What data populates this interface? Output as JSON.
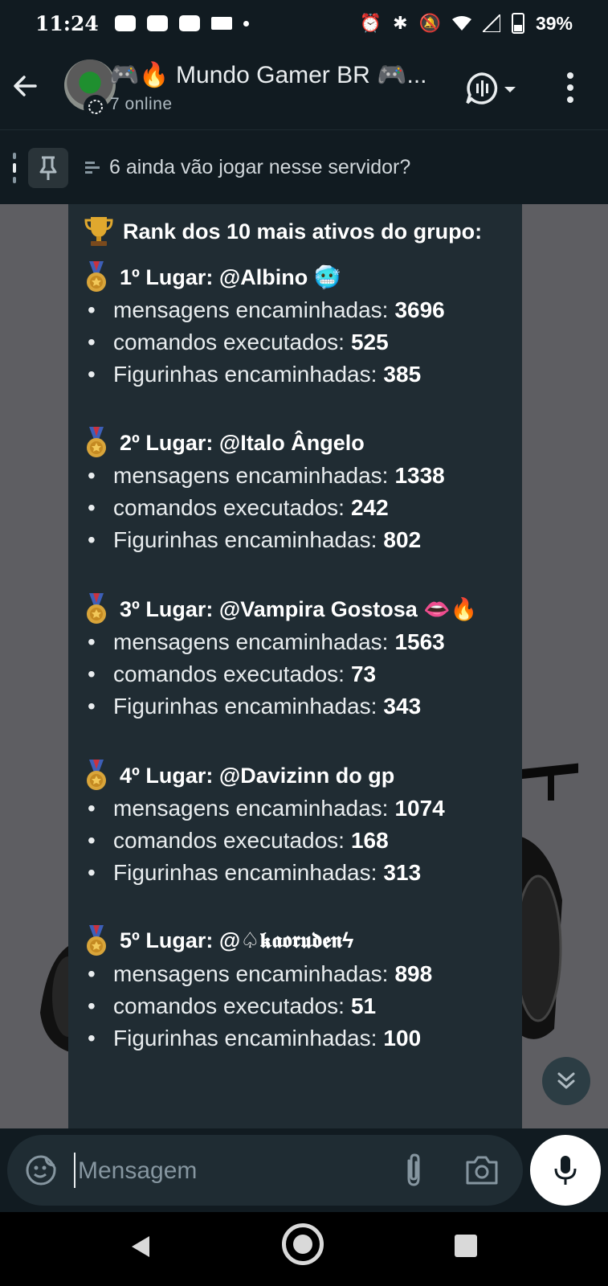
{
  "status_bar": {
    "time": "11:24",
    "battery": "39%"
  },
  "header": {
    "group_name": "🎮🔥 Mundo Gamer BR 🎮...",
    "online": "7 online"
  },
  "pinned": {
    "text": "6 ainda vão jogar nesse servidor?"
  },
  "message": {
    "title": "Rank dos 10 mais ativos do grupo:",
    "entries": [
      {
        "place": "1º Lugar: @Albino 🥶",
        "lines": [
          {
            "label": "mensagens encaminhadas:",
            "value": "3696"
          },
          {
            "label": "comandos executados:",
            "value": "525"
          },
          {
            "label": "Figurinhas encaminhadas:",
            "value": "385"
          }
        ]
      },
      {
        "place": "2º Lugar: @Italo Ângelo",
        "lines": [
          {
            "label": "mensagens encaminhadas:",
            "value": "1338"
          },
          {
            "label": "comandos executados:",
            "value": "242"
          },
          {
            "label": "Figurinhas encaminhadas:",
            "value": "802"
          }
        ]
      },
      {
        "place": "3º Lugar: @Vampira Gostosa 👄🔥",
        "lines": [
          {
            "label": "mensagens encaminhadas:",
            "value": "1563"
          },
          {
            "label": "comandos executados:",
            "value": "73"
          },
          {
            "label": "Figurinhas encaminhadas:",
            "value": "343"
          }
        ]
      },
      {
        "place": "4º Lugar: @Davizinn do gp",
        "lines": [
          {
            "label": "mensagens encaminhadas:",
            "value": "1074"
          },
          {
            "label": "comandos executados:",
            "value": "168"
          },
          {
            "label": "Figurinhas encaminhadas:",
            "value": "313"
          }
        ]
      },
      {
        "place": "5º Lugar: @♤𝖐𝖆𝖔𝖗𝖚𝖉𝖊𝖓ϟ",
        "lines": [
          {
            "label": "mensagens encaminhadas:",
            "value": "898"
          },
          {
            "label": "comandos executados:",
            "value": "51"
          },
          {
            "label": "Figurinhas encaminhadas:",
            "value": "100"
          }
        ]
      }
    ]
  },
  "composer": {
    "placeholder": "Mensagem"
  },
  "colors": {
    "bar_bg": "#111b21",
    "bubble_bg": "#202c33",
    "wallpaper": "#5e5e62"
  },
  "icons": [
    "back-arrow-icon",
    "voice-chat-icon",
    "more-vert-icon",
    "pin-icon",
    "poll-icon",
    "trophy-icon",
    "medal-icon",
    "emoji-icon",
    "attach-icon",
    "camera-icon",
    "mic-icon",
    "chevrons-down-icon"
  ]
}
